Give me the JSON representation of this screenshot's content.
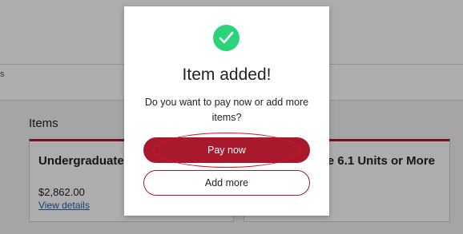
{
  "background": {
    "band_text": "s",
    "items_heading": "Items",
    "cards": [
      {
        "title": "Undergraduate",
        "price": "$2,862.00",
        "link": "View details"
      },
      {
        "title": "e 6.1 Units or More"
      }
    ]
  },
  "modal": {
    "icon": "check-circle-icon",
    "title": "Item added!",
    "question": "Do you want to pay now or add more items?",
    "primary_button": "Pay now",
    "secondary_button": "Add more"
  },
  "colors": {
    "accent": "#a8192e",
    "success": "#2bd37a",
    "annotation": "#e0101a"
  }
}
